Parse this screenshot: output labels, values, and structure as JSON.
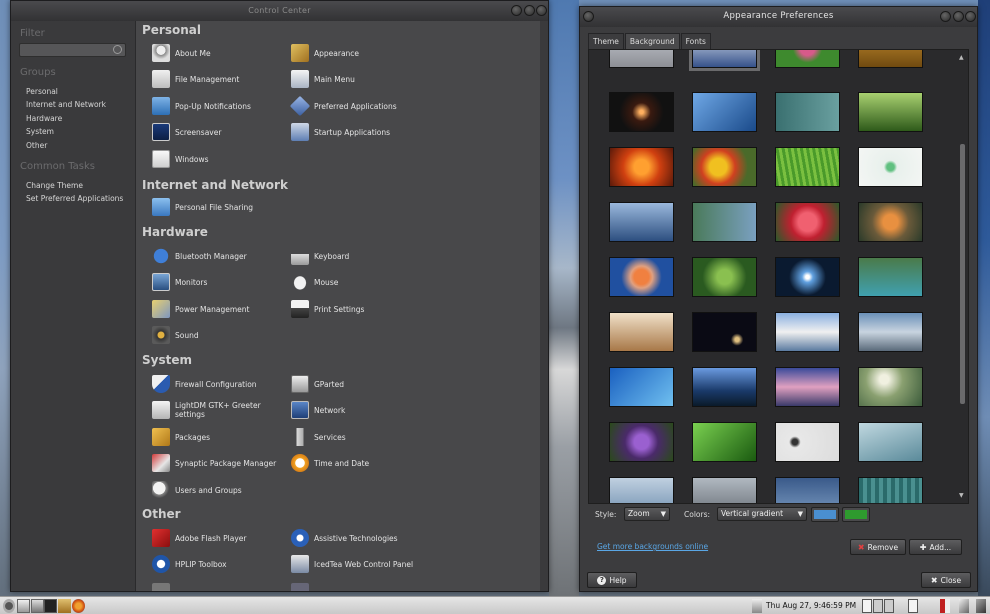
{
  "control_center": {
    "title": "Control Center",
    "filter_heading": "Filter",
    "filter_placeholder": "",
    "groups_heading": "Groups",
    "groups": [
      "Personal",
      "Internet and Network",
      "Hardware",
      "System",
      "Other"
    ],
    "tasks_heading": "Common Tasks",
    "tasks": [
      "Change Theme",
      "Set Preferred Applications"
    ],
    "sections": {
      "personal": {
        "title": "Personal",
        "items": [
          "About Me",
          "Appearance",
          "File Management",
          "Main Menu",
          "Pop-Up Notifications",
          "Preferred Applications",
          "Screensaver",
          "Startup Applications",
          "Windows"
        ]
      },
      "internet": {
        "title": "Internet and Network",
        "items": [
          "Personal File Sharing"
        ]
      },
      "hardware": {
        "title": "Hardware",
        "items": [
          "Bluetooth Manager",
          "Keyboard",
          "Monitors",
          "Mouse",
          "Power Management",
          "Print Settings",
          "Sound"
        ]
      },
      "system": {
        "title": "System",
        "items": [
          "Firewall Configuration",
          "GParted",
          "LightDM GTK+ Greeter settings",
          "Network",
          "Packages",
          "Services",
          "Synaptic Package Manager",
          "Time and Date",
          "Users and Groups"
        ]
      },
      "other": {
        "title": "Other",
        "items": [
          "Adobe Flash Player",
          "Assistive Technologies",
          "HPLIP Toolbox",
          "IcedTea Web Control Panel"
        ]
      }
    }
  },
  "appearance": {
    "title": "Appearance Preferences",
    "tabs": [
      "Theme",
      "Background",
      "Fonts"
    ],
    "active_tab": "Background",
    "style_label": "Style:",
    "style_value": "Zoom",
    "colors_label": "Colors:",
    "colors_value": "Vertical gradient",
    "color1": "#4a8fd0",
    "color2": "#2e9a2e",
    "more_link": "Get more backgrounds online",
    "remove_label": "Remove",
    "add_label": "Add...",
    "help_label": "Help",
    "close_label": "Close"
  },
  "taskbar": {
    "clock": "Thu Aug 27,  9:46:59 PM"
  }
}
